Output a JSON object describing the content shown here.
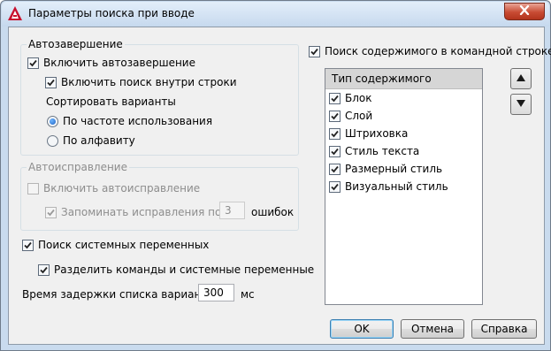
{
  "window": {
    "title": "Параметры поиска при вводе"
  },
  "autocomplete": {
    "legend": "Автозавершение",
    "enable_label": "Включить автозавершение",
    "enable_checked": true,
    "substring_label": "Включить поиск внутри строки",
    "substring_checked": true,
    "sort_label": "Сортировать варианты",
    "sort_options": [
      {
        "label": "По частоте использования",
        "selected": true
      },
      {
        "label": "По алфавиту",
        "selected": false
      }
    ]
  },
  "autocorrect": {
    "legend": "Автоисправление",
    "enable_label": "Включить автоисправление",
    "enable_checked": false,
    "remember_label": "Запоминать исправления после",
    "remember_checked": true,
    "remember_value": "3",
    "errors_label": "ошибок"
  },
  "sysvars": {
    "search_label": "Поиск системных переменных",
    "search_checked": true,
    "separate_label": "Разделить команды и системные переменные",
    "separate_checked": true
  },
  "delay": {
    "label": "Время задержки списка вариантов",
    "value": "300",
    "unit": "мс"
  },
  "content_search": {
    "label": "Поиск содержимого в командной строке",
    "checked": true,
    "list_header": "Тип содержимого",
    "items": [
      {
        "label": "Блок",
        "checked": true
      },
      {
        "label": "Слой",
        "checked": true
      },
      {
        "label": "Штриховка",
        "checked": true
      },
      {
        "label": "Стиль текста",
        "checked": true
      },
      {
        "label": "Размерный стиль",
        "checked": true
      },
      {
        "label": "Визуальный стиль",
        "checked": true
      }
    ]
  },
  "buttons": {
    "ok": "OK",
    "cancel": "Отмена",
    "help": "Справка"
  },
  "colors": {
    "accent": "#3c7fb1",
    "close_button": "#c84b33",
    "app_icon": "#c8102e"
  },
  "icons": [
    "autocad-app-icon",
    "close-icon",
    "up-arrow-icon",
    "down-arrow-icon",
    "checkmark-icon"
  ]
}
